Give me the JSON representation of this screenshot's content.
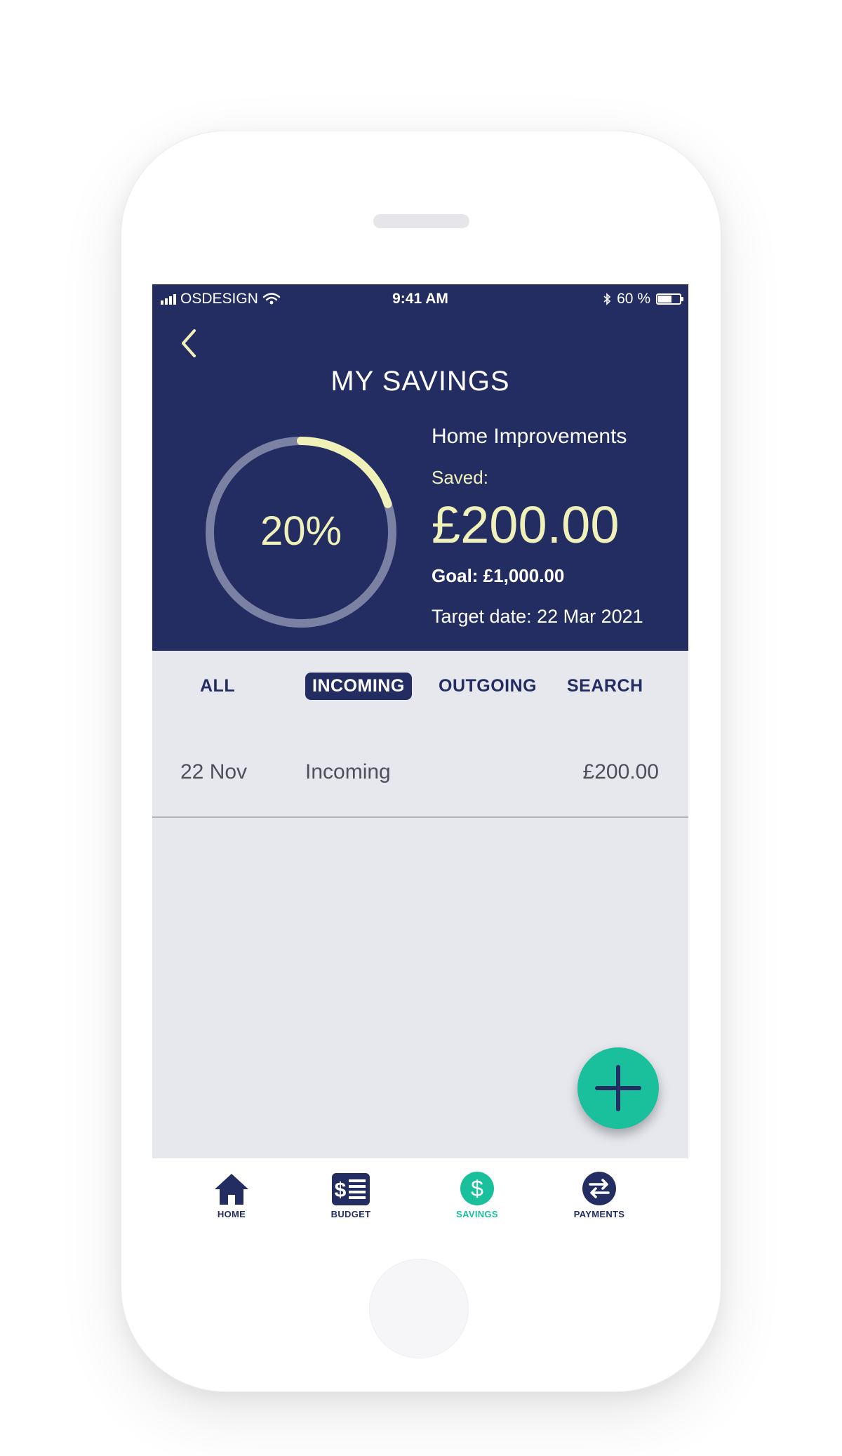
{
  "status_bar": {
    "carrier": "OSDESIGN",
    "time": "9:41 AM",
    "battery": "60 %",
    "icons": [
      "signal-icon",
      "wifi-icon",
      "bluetooth-icon",
      "battery-icon"
    ]
  },
  "header": {
    "title": "MY SAVINGS",
    "back_icon": "chevron-left-icon"
  },
  "savings": {
    "progress_percent": 20,
    "progress_label": "20%",
    "goal_name": "Home Improvements",
    "saved_label": "Saved:",
    "saved_amount": "£200.00",
    "goal": "Goal: £1,000.00",
    "target_date": "Target date: 22 Mar 2021"
  },
  "tabs": [
    {
      "label": "ALL",
      "active": false
    },
    {
      "label": "INCOMING",
      "active": true
    },
    {
      "label": "OUTGOING",
      "active": false
    },
    {
      "label": "SEARCH",
      "active": false
    }
  ],
  "transactions": [
    {
      "date": "22 Nov",
      "type": "Incoming",
      "amount": "£200.00"
    }
  ],
  "fab": {
    "icon": "plus-icon"
  },
  "bottom_nav": [
    {
      "label": "HOME",
      "icon": "home-icon",
      "active": false
    },
    {
      "label": "BUDGET",
      "icon": "budget-list-icon",
      "active": false
    },
    {
      "label": "SAVINGS",
      "icon": "dollar-circle-icon",
      "active": true
    },
    {
      "label": "PAYMENTS",
      "icon": "transfer-arrows-icon",
      "active": false
    }
  ],
  "colors": {
    "navy": "#232d62",
    "accent_yellow": "#f0f1b8",
    "accent_green": "#1abf9b",
    "ring_track": "#7b81a3",
    "list_bg": "#e7e8ee"
  }
}
